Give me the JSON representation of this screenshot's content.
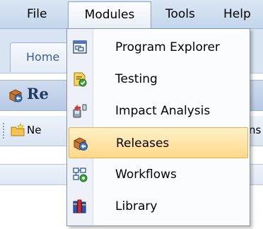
{
  "menubar": {
    "items": [
      "File",
      "Modules",
      "Tools",
      "Help"
    ]
  },
  "background": {
    "home_tab": "Home",
    "panel_title": "Re",
    "toolbar_new": "Ne",
    "toolbar_right": "ns"
  },
  "dropdown": {
    "items": [
      {
        "label": "Program Explorer",
        "icon": "program-explorer-icon"
      },
      {
        "label": "Testing",
        "icon": "testing-icon"
      },
      {
        "label": "Impact Analysis",
        "icon": "impact-analysis-icon"
      },
      {
        "label": "Releases",
        "icon": "releases-icon"
      },
      {
        "label": "Workflows",
        "icon": "workflows-icon"
      },
      {
        "label": "Library",
        "icon": "library-icon"
      }
    ],
    "selected": "Releases"
  },
  "colors": {
    "menubar": "#c4d6ec",
    "highlight": "#ffd889",
    "highlight_border": "#e3b24c"
  }
}
